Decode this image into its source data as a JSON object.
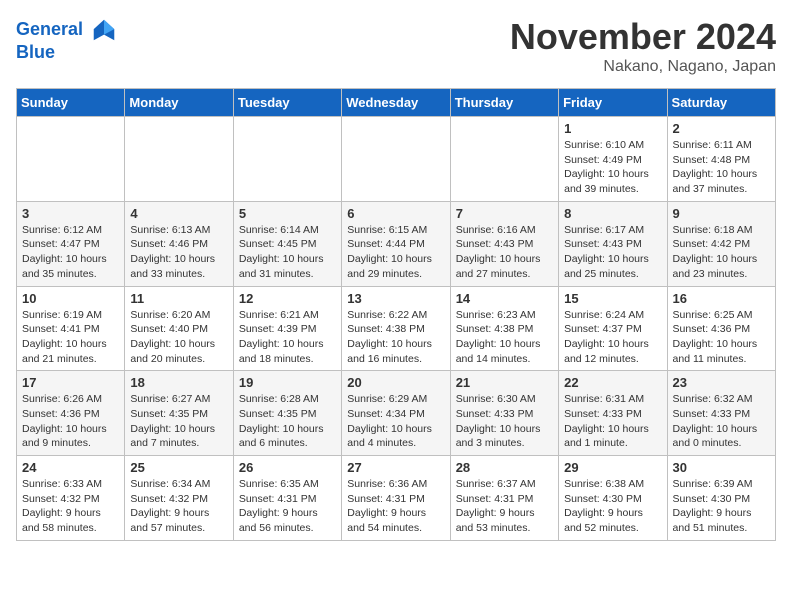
{
  "header": {
    "logo_line1": "General",
    "logo_line2": "Blue",
    "month": "November 2024",
    "location": "Nakano, Nagano, Japan"
  },
  "weekdays": [
    "Sunday",
    "Monday",
    "Tuesday",
    "Wednesday",
    "Thursday",
    "Friday",
    "Saturday"
  ],
  "weeks": [
    [
      {
        "day": "",
        "detail": ""
      },
      {
        "day": "",
        "detail": ""
      },
      {
        "day": "",
        "detail": ""
      },
      {
        "day": "",
        "detail": ""
      },
      {
        "day": "",
        "detail": ""
      },
      {
        "day": "1",
        "detail": "Sunrise: 6:10 AM\nSunset: 4:49 PM\nDaylight: 10 hours\nand 39 minutes."
      },
      {
        "day": "2",
        "detail": "Sunrise: 6:11 AM\nSunset: 4:48 PM\nDaylight: 10 hours\nand 37 minutes."
      }
    ],
    [
      {
        "day": "3",
        "detail": "Sunrise: 6:12 AM\nSunset: 4:47 PM\nDaylight: 10 hours\nand 35 minutes."
      },
      {
        "day": "4",
        "detail": "Sunrise: 6:13 AM\nSunset: 4:46 PM\nDaylight: 10 hours\nand 33 minutes."
      },
      {
        "day": "5",
        "detail": "Sunrise: 6:14 AM\nSunset: 4:45 PM\nDaylight: 10 hours\nand 31 minutes."
      },
      {
        "day": "6",
        "detail": "Sunrise: 6:15 AM\nSunset: 4:44 PM\nDaylight: 10 hours\nand 29 minutes."
      },
      {
        "day": "7",
        "detail": "Sunrise: 6:16 AM\nSunset: 4:43 PM\nDaylight: 10 hours\nand 27 minutes."
      },
      {
        "day": "8",
        "detail": "Sunrise: 6:17 AM\nSunset: 4:43 PM\nDaylight: 10 hours\nand 25 minutes."
      },
      {
        "day": "9",
        "detail": "Sunrise: 6:18 AM\nSunset: 4:42 PM\nDaylight: 10 hours\nand 23 minutes."
      }
    ],
    [
      {
        "day": "10",
        "detail": "Sunrise: 6:19 AM\nSunset: 4:41 PM\nDaylight: 10 hours\nand 21 minutes."
      },
      {
        "day": "11",
        "detail": "Sunrise: 6:20 AM\nSunset: 4:40 PM\nDaylight: 10 hours\nand 20 minutes."
      },
      {
        "day": "12",
        "detail": "Sunrise: 6:21 AM\nSunset: 4:39 PM\nDaylight: 10 hours\nand 18 minutes."
      },
      {
        "day": "13",
        "detail": "Sunrise: 6:22 AM\nSunset: 4:38 PM\nDaylight: 10 hours\nand 16 minutes."
      },
      {
        "day": "14",
        "detail": "Sunrise: 6:23 AM\nSunset: 4:38 PM\nDaylight: 10 hours\nand 14 minutes."
      },
      {
        "day": "15",
        "detail": "Sunrise: 6:24 AM\nSunset: 4:37 PM\nDaylight: 10 hours\nand 12 minutes."
      },
      {
        "day": "16",
        "detail": "Sunrise: 6:25 AM\nSunset: 4:36 PM\nDaylight: 10 hours\nand 11 minutes."
      }
    ],
    [
      {
        "day": "17",
        "detail": "Sunrise: 6:26 AM\nSunset: 4:36 PM\nDaylight: 10 hours\nand 9 minutes."
      },
      {
        "day": "18",
        "detail": "Sunrise: 6:27 AM\nSunset: 4:35 PM\nDaylight: 10 hours\nand 7 minutes."
      },
      {
        "day": "19",
        "detail": "Sunrise: 6:28 AM\nSunset: 4:35 PM\nDaylight: 10 hours\nand 6 minutes."
      },
      {
        "day": "20",
        "detail": "Sunrise: 6:29 AM\nSunset: 4:34 PM\nDaylight: 10 hours\nand 4 minutes."
      },
      {
        "day": "21",
        "detail": "Sunrise: 6:30 AM\nSunset: 4:33 PM\nDaylight: 10 hours\nand 3 minutes."
      },
      {
        "day": "22",
        "detail": "Sunrise: 6:31 AM\nSunset: 4:33 PM\nDaylight: 10 hours\nand 1 minute."
      },
      {
        "day": "23",
        "detail": "Sunrise: 6:32 AM\nSunset: 4:33 PM\nDaylight: 10 hours\nand 0 minutes."
      }
    ],
    [
      {
        "day": "24",
        "detail": "Sunrise: 6:33 AM\nSunset: 4:32 PM\nDaylight: 9 hours\nand 58 minutes."
      },
      {
        "day": "25",
        "detail": "Sunrise: 6:34 AM\nSunset: 4:32 PM\nDaylight: 9 hours\nand 57 minutes."
      },
      {
        "day": "26",
        "detail": "Sunrise: 6:35 AM\nSunset: 4:31 PM\nDaylight: 9 hours\nand 56 minutes."
      },
      {
        "day": "27",
        "detail": "Sunrise: 6:36 AM\nSunset: 4:31 PM\nDaylight: 9 hours\nand 54 minutes."
      },
      {
        "day": "28",
        "detail": "Sunrise: 6:37 AM\nSunset: 4:31 PM\nDaylight: 9 hours\nand 53 minutes."
      },
      {
        "day": "29",
        "detail": "Sunrise: 6:38 AM\nSunset: 4:30 PM\nDaylight: 9 hours\nand 52 minutes."
      },
      {
        "day": "30",
        "detail": "Sunrise: 6:39 AM\nSunset: 4:30 PM\nDaylight: 9 hours\nand 51 minutes."
      }
    ]
  ]
}
